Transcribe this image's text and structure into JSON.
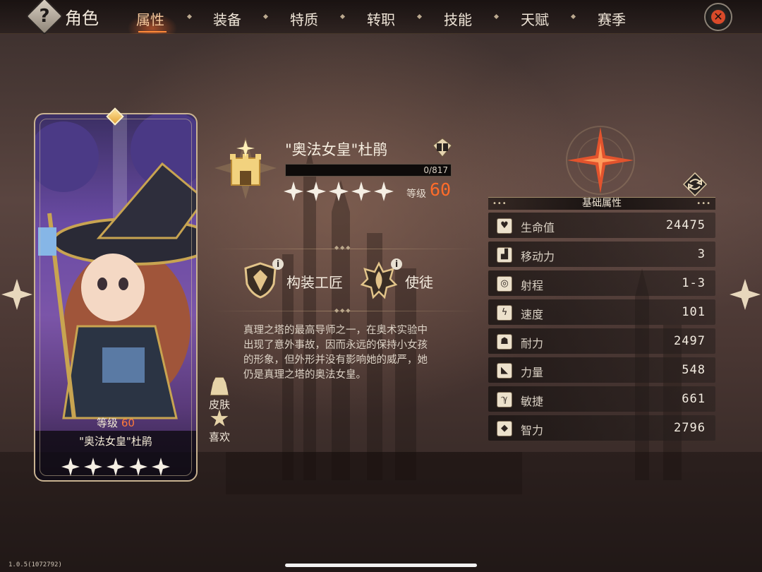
{
  "header": {
    "help_glyph": "?",
    "title": "角色",
    "tabs": [
      {
        "label": "属性",
        "active": true
      },
      {
        "label": "装备",
        "active": false
      },
      {
        "label": "特质",
        "active": false
      },
      {
        "label": "转职",
        "active": false
      },
      {
        "label": "技能",
        "active": false
      },
      {
        "label": "天赋",
        "active": false
      },
      {
        "label": "赛季",
        "active": false
      }
    ],
    "close_glyph": "✕",
    "accent_color": "#ff7a3a"
  },
  "card": {
    "level_label": "等级",
    "level_value": "60",
    "name": "\"奥法女皇\"杜鹃",
    "star_count": 5
  },
  "side_buttons": {
    "skin_label": "皮肤",
    "like_label": "喜欢"
  },
  "hero": {
    "title": "\"奥法女皇\"杜鹃",
    "exp_text": "0/817",
    "exp_fraction": 0,
    "star_count": 5,
    "level_label": "等级",
    "level_value": "60",
    "traits": [
      {
        "label": "构装工匠",
        "info": "i",
        "icon": "shield-crest-icon"
      },
      {
        "label": "使徒",
        "info": "i",
        "icon": "flame-crest-icon"
      }
    ],
    "description": "真理之塔的最高导师之一，在奥术实验中出现了意外事故，因而永远的保持小女孩的形象，但外形并没有影响她的威严，她仍是真理之塔的奥法女皇。"
  },
  "stats": {
    "header": "基础属性",
    "header_dots": "•••",
    "rows": [
      {
        "label": "生命值",
        "value": "24475",
        "icon": "heart-icon",
        "glyph": "♥"
      },
      {
        "label": "移动力",
        "value": "3",
        "icon": "boot-icon",
        "glyph": "▟"
      },
      {
        "label": "射程",
        "value": "1-3",
        "icon": "target-icon",
        "glyph": "◎"
      },
      {
        "label": "速度",
        "value": "101",
        "icon": "lightning-icon",
        "glyph": "ϟ"
      },
      {
        "label": "耐力",
        "value": "2497",
        "icon": "person-icon",
        "glyph": "☗"
      },
      {
        "label": "力量",
        "value": "548",
        "icon": "arm-icon",
        "glyph": "◣"
      },
      {
        "label": "敏捷",
        "value": "661",
        "icon": "feather-icon",
        "glyph": "ℽ"
      },
      {
        "label": "智力",
        "value": "2796",
        "icon": "diamond-icon",
        "glyph": "◆"
      }
    ]
  },
  "footer": {
    "version": "1.0.5(1072792)"
  }
}
